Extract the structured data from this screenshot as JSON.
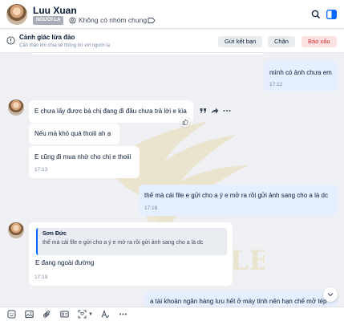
{
  "header": {
    "name": "Luu Xuan",
    "badge": "NGƯỜI LẠ",
    "group_status": "Không có nhóm chung"
  },
  "banner": {
    "title": "Cảnh giác lừa đảo",
    "subtitle": "Cẩn thận khi chia sẻ thông tin với người lạ",
    "add_friend": "Gửi kết bạn",
    "block": "Chặn",
    "report": "Báo xấu"
  },
  "messages": {
    "m1": {
      "text": "mình có ảnh chưa em",
      "time": "17:12"
    },
    "m2": {
      "text": "E chưa lấy được bà chị đang đi đâu chưa trả lời e kìa"
    },
    "m3": {
      "text": "Nếu mà khó quá thoiii ah ạ"
    },
    "m4": {
      "text": "E cũng đi mua nhờ cho chị e thoiii",
      "time": "17:13"
    },
    "m5": {
      "text": "thế mà cái file e gửi cho a ý e mở ra rồi gửi ảnh sang cho a là dc",
      "time": "17:18"
    },
    "m6": {
      "quote_author": "Sơn Đức",
      "quote_text": "thế mà cái file e gửi cho a ý e mở ra rồi gửi ảnh sang cho a là dc",
      "text": "E đang ngoài đường",
      "time": "17:19"
    },
    "m7": {
      "text": "a tài khoản ngân hàng lưu hết ở máy tính nên hạn chế mở tép"
    }
  },
  "colors": {
    "accent": "#0068ff",
    "report": "#e03131",
    "outgoing_bubble": "#e5efff"
  },
  "toolbar_icons": [
    "sticker-icon",
    "image-icon",
    "attachment-icon",
    "business-card-icon",
    "screenshot-icon",
    "format-icon",
    "more-icon"
  ]
}
